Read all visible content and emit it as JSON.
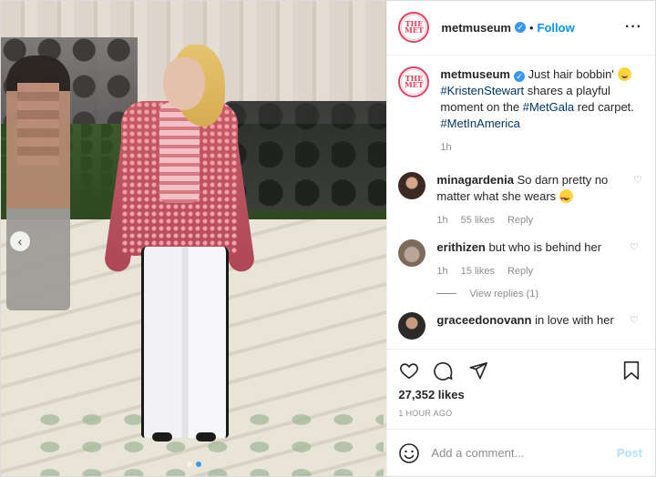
{
  "account": {
    "username": "metmuseum",
    "avatar_text": "THE MET",
    "follow_label": "Follow",
    "verified": true
  },
  "caption": {
    "username": "metmuseum",
    "text_pre": "Just hair bobbin'",
    "tag_person": "#KristenStewart",
    "text_mid": "shares a playful moment on the",
    "tag_event": "#MetGala",
    "text_post": "red carpet.",
    "tag_theme": "#MetInAmerica",
    "time": "1h"
  },
  "comments": [
    {
      "username": "minagardenia",
      "text": "So darn pretty no matter what she wears",
      "time": "1h",
      "likes": "55 likes",
      "reply_label": "Reply"
    },
    {
      "username": "erithizen",
      "text": "but who is behind her",
      "time": "1h",
      "likes": "15 likes",
      "reply_label": "Reply",
      "view_replies": "View replies (1)"
    },
    {
      "username": "graceedonovann",
      "text": "in love with her"
    }
  ],
  "post": {
    "likes": "27,352 likes",
    "time_ago": "1 HOUR AGO",
    "comment_placeholder": "Add a comment...",
    "post_label": "Post"
  },
  "carousel": {
    "total": 2,
    "active_index": 1
  },
  "icons": [
    "more-options-icon",
    "verified-icon",
    "like-heart-icon",
    "comment-icon",
    "share-icon",
    "bookmark-icon",
    "emoji-icon",
    "carousel-prev-icon"
  ],
  "colors": {
    "link": "#00376b",
    "follow": "#0095f6",
    "brand": "#e4405f",
    "post_disabled": "#b2dffc"
  }
}
